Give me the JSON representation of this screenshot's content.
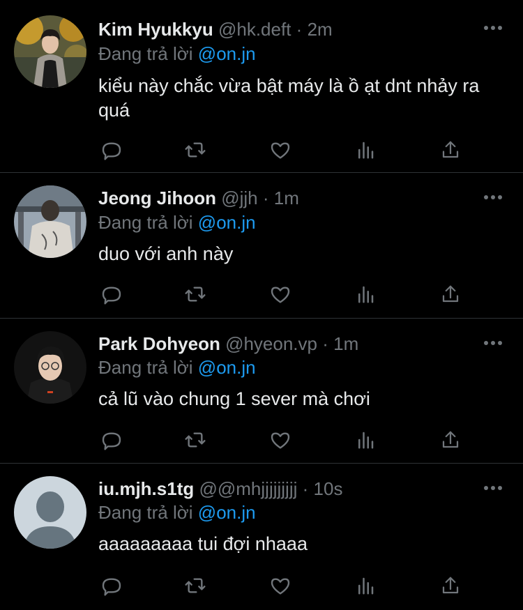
{
  "colors": {
    "background": "#000000",
    "text": "#e7e9ea",
    "muted": "#71767b",
    "mention": "#1d9bf0",
    "divider": "#2f3336"
  },
  "replies": [
    {
      "name": "Kim Hyukkyu",
      "handle": "@hk.deft",
      "separator": "·",
      "time": "2m",
      "replying_prefix": "Đang trả lời",
      "replying_to": "@on.jn",
      "text": "kiểu này chắc vừa bật máy là ồ ạt dnt nhảy ra quá",
      "avatar": "photo-user-avatar"
    },
    {
      "name": "Jeong Jihoon",
      "handle": "@jjh",
      "separator": "·",
      "time": "1m",
      "replying_prefix": "Đang trả lời",
      "replying_to": "@on.jn",
      "text": "duo với anh này",
      "avatar": "photo-user-avatar"
    },
    {
      "name": "Park Dohyeon",
      "handle": "@hyeon.vp",
      "separator": "·",
      "time": "1m",
      "replying_prefix": "Đang trả lời",
      "replying_to": "@on.jn",
      "text": "cả lũ vào chung 1 sever mà chơi",
      "avatar": "photo-user-avatar"
    },
    {
      "name": "iu.mjh.s1tg",
      "handle": "@@mhjjjjjjjjj",
      "separator": "·",
      "time": "10s",
      "replying_prefix": "Đang trả lời",
      "replying_to": "@on.jn",
      "text": "aaaaaaaaa tui đợi nhaaa",
      "avatar": "default-avatar"
    }
  ],
  "action_icons": [
    "reply-icon",
    "retweet-icon",
    "like-icon",
    "analytics-icon",
    "share-icon"
  ]
}
